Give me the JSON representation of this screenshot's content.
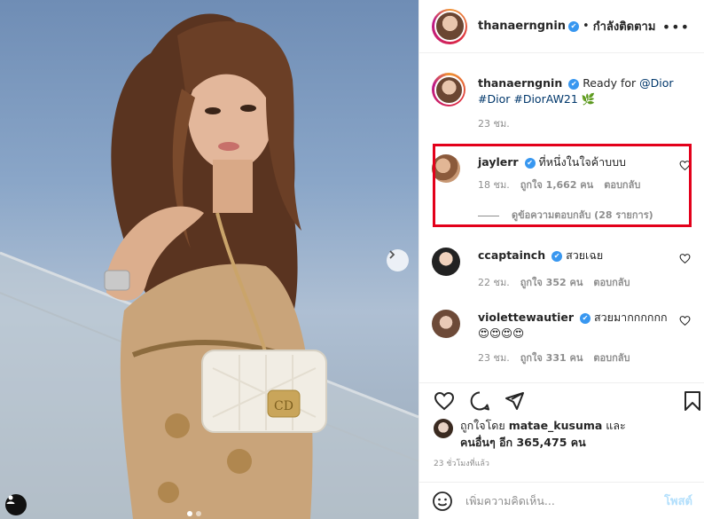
{
  "header": {
    "username": "thanaerngnin",
    "verified_mark": "✔",
    "separator": "•",
    "follow_label": "กำลังติดตาม",
    "more_label": "•••"
  },
  "caption": {
    "username": "thanaerngnin",
    "text_pre": "Ready for ",
    "mention": "@Dior",
    "hashtag1": "#Dior",
    "hashtag2": "#DiorAW21",
    "emoji": "🌿",
    "time": "23 ชม."
  },
  "comments": [
    {
      "username": "jaylerr",
      "text": "ที่หนึ่งในใจค้าบบบ",
      "time": "18 ชม.",
      "likes": "ถูกใจ 1,662 คน",
      "reply_label": "ตอบกลับ",
      "view_replies": "ดูข้อความตอบกลับ (28 รายการ)"
    },
    {
      "username": "ccaptainch",
      "text": "สวยเฉย",
      "time": "22 ชม.",
      "likes": "ถูกใจ 352 คน",
      "reply_label": "ตอบกลับ"
    },
    {
      "username": "violettewautier",
      "text": "สวยมากกกกกก",
      "emoji": "😍😍😍😍",
      "time": "23 ชม.",
      "likes": "ถูกใจ 331 คน",
      "reply_label": "ตอบกลับ"
    }
  ],
  "liked_by": {
    "prefix": "ถูกใจโดย ",
    "user": "matae_kusuma",
    "conj": " และ",
    "others": "คนอื่นๆ อีก 365,475 คน"
  },
  "time_ago": "23 ชั่วโมงที่แล้ว",
  "add_comment": {
    "placeholder": "เพิ่มความคิดเห็น...",
    "post_label": "โพสต์"
  },
  "colors": {
    "verified": "#3897f0",
    "highlight": "#e3001b",
    "link": "#00376b",
    "post_disabled": "#b2dffc"
  }
}
